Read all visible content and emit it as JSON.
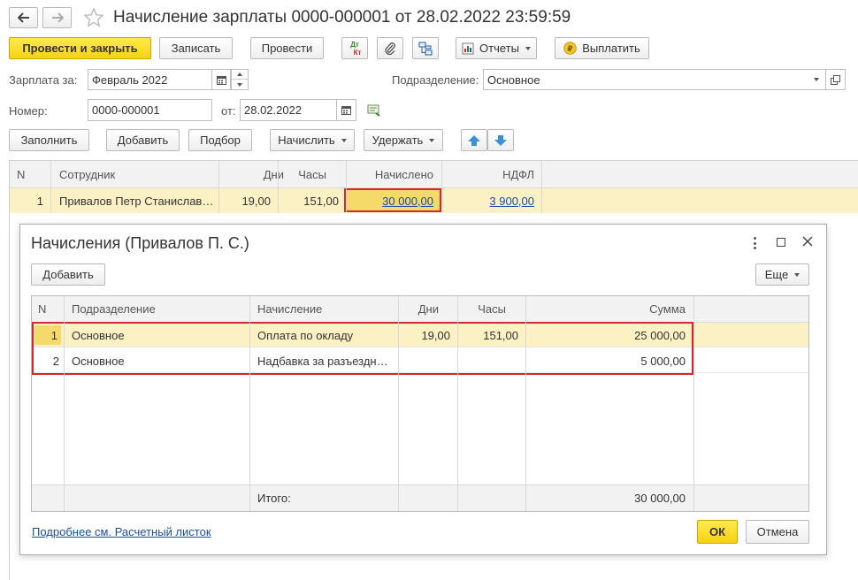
{
  "window": {
    "title": "Начисление зарплаты 0000-000001 от 28.02.2022 23:59:59"
  },
  "toolbar": {
    "post_close": "Провести и закрыть",
    "save": "Записать",
    "post": "Провести",
    "dtkt_top": "Дт",
    "dtkt_bottom": "Кт",
    "reports": "Отчеты",
    "pay": "Выплатить"
  },
  "form": {
    "salary_label": "Зарплата за:",
    "salary_value": "Февраль 2022",
    "department_label": "Подразделение:",
    "department_value": "Основное",
    "number_label": "Номер:",
    "number_value": "0000-000001",
    "date_label": "от:",
    "date_value": "28.02.2022"
  },
  "table_toolbar": {
    "fill": "Заполнить",
    "add": "Добавить",
    "pick": "Подбор",
    "accrue": "Начислить",
    "withhold": "Удержать"
  },
  "main_table": {
    "columns": [
      "N",
      "Сотрудник",
      "Дни",
      "Часы",
      "Начислено",
      "НДФЛ"
    ],
    "rows": [
      {
        "n": "1",
        "employee": "Привалов Петр Станислав…",
        "days": "19,00",
        "hours": "151,00",
        "accrued": "30 000,00",
        "ndfl": "3 900,00"
      }
    ]
  },
  "dialog": {
    "title": "Начисления (Привалов П. С.)",
    "add": "Добавить",
    "more": "Еще",
    "columns": [
      "N",
      "Подразделение",
      "Начисление",
      "Дни",
      "Часы",
      "Сумма"
    ],
    "rows": [
      {
        "n": "1",
        "department": "Основное",
        "accrual": "Оплата по окладу",
        "days": "19,00",
        "hours": "151,00",
        "sum": "25 000,00"
      },
      {
        "n": "2",
        "department": "Основное",
        "accrual": "Надбавка за разъездн…",
        "days": "",
        "hours": "",
        "sum": "5 000,00"
      }
    ],
    "total_label": "Итого:",
    "total_value": "30 000,00",
    "payslip_link": "Подробнее см. Расчетный листок",
    "ok": "ОК",
    "cancel": "Отмена"
  },
  "colors": {
    "accent_yellow": "#f6d214",
    "highlight_row": "#fbf1c4",
    "selection_red": "#d9262e",
    "link_blue": "#1a4ea3"
  }
}
